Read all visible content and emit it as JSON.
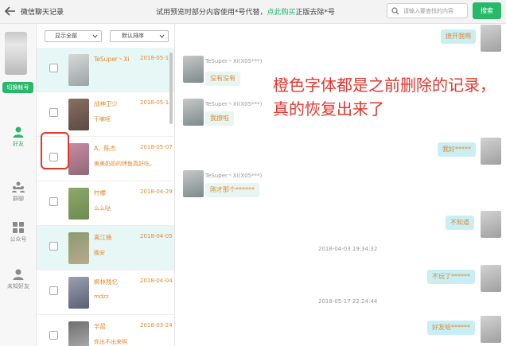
{
  "window": {
    "title": "微信聊天记录",
    "trial_notice_prefix": "试用预览时部分内容使用*号代替，",
    "trial_notice_link": "点此购买",
    "trial_notice_suffix": "正版去除*号"
  },
  "search": {
    "placeholder": "请输入要查找的内容",
    "button_label": "搜索"
  },
  "rail": {
    "switch_account_label": "切换帐号",
    "items": [
      {
        "label": "好友",
        "icon": "person-icon",
        "active": true
      },
      {
        "label": "群聊",
        "icon": "group-icon",
        "active": false
      },
      {
        "label": "公众号",
        "icon": "grid-icon",
        "active": false
      },
      {
        "label": "未知好友",
        "icon": "unknown-person-icon",
        "active": false
      }
    ]
  },
  "filters": {
    "show_label": "显示全部",
    "sort_label": "默认排序"
  },
  "contacts": [
    {
      "name": "TeSuper丶Xi",
      "date": "2018-05-17",
      "preview": "",
      "selected": true
    },
    {
      "name": "战神卫少",
      "date": "2018-05-15",
      "preview": "干嘛呢",
      "selected": false
    },
    {
      "name": "A、陈杰",
      "date": "2018-05-07",
      "preview": "美美奶奶的烤鱼真好吃。",
      "selected": false
    },
    {
      "name": "柠檬",
      "date": "2018-04-29",
      "preview": "么么哒",
      "selected": false
    },
    {
      "name": "离江楠",
      "date": "2018-04-05",
      "preview": "晚安",
      "selected": true
    },
    {
      "name": "枫林残忆",
      "date": "2018-04-04",
      "preview": "mdzz",
      "selected": false
    },
    {
      "name": "学晨",
      "date": "2018-03-24",
      "preview": "你出不出来啊",
      "selected": false
    }
  ],
  "messages": [
    {
      "direction": "out",
      "text": "撩开我啊"
    },
    {
      "direction": "in",
      "sender": "TeSuper丶Xi(X05***)",
      "text": "没有没有"
    },
    {
      "direction": "in",
      "sender": "TeSuper丶Xi(X05***)",
      "text": "我撩啦"
    },
    {
      "direction": "out",
      "text": "我好*****"
    },
    {
      "direction": "in",
      "sender": "TeSuper丶Xi(X05***)",
      "text": "刚才那个******"
    },
    {
      "direction": "out",
      "text": "不知道"
    },
    {
      "direction": "time",
      "text": "2018-04-03 19:34:32"
    },
    {
      "direction": "out",
      "text": "不玩了******"
    },
    {
      "direction": "time",
      "text": "2018-05-17 22:24:44"
    },
    {
      "direction": "out",
      "text": "好友哈******"
    }
  ],
  "annotation": {
    "text": "橙色字体都是之前删除的记录，真的恢复出来了"
  },
  "colors": {
    "accent_green": "#28b86a",
    "deleted_orange": "#e08a2e",
    "annotation_red": "#e2372e",
    "bubble_out": "#c9eef4",
    "bubble_in": "#e7f6f3"
  }
}
